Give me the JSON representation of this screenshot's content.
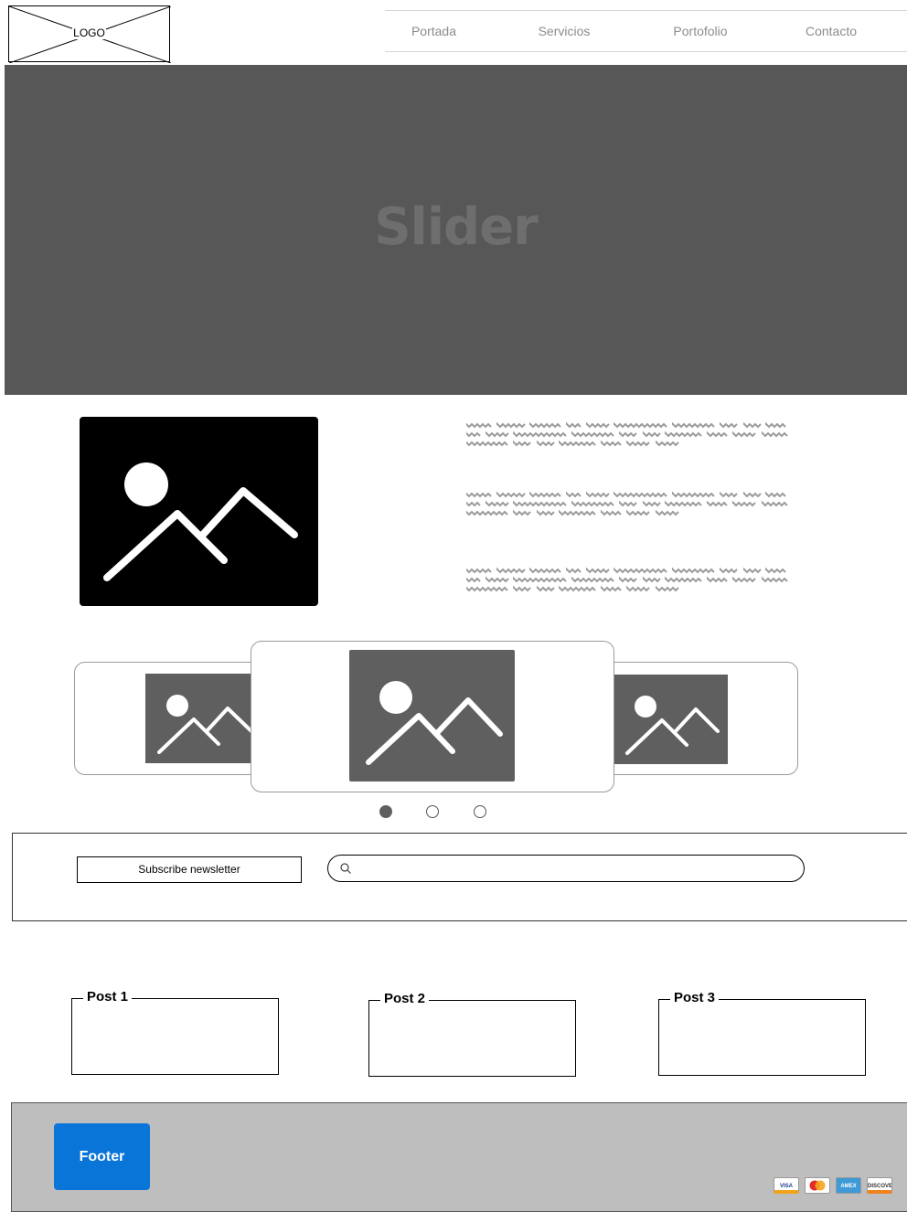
{
  "header": {
    "logo_text": "LOGO",
    "nav": [
      "Portada",
      "Servicios",
      "Portofolio",
      "Contacto"
    ]
  },
  "hero": {
    "title": "Slider"
  },
  "carousel": {
    "pages": 3,
    "active_index": 0
  },
  "newsletter": {
    "button_label": "Subscribe newsletter",
    "search_placeholder": ""
  },
  "posts": [
    "Post 1",
    "Post 2",
    "Post 3"
  ],
  "footer": {
    "button_label": "Footer",
    "payment_cards": [
      "VISA",
      "MasterCard",
      "AMEX",
      "DISCOVER"
    ]
  },
  "colors": {
    "hero_bg": "#575757",
    "footer_bg": "#bebebe",
    "footer_button": "#0a75d8",
    "image_placeholder": "#5f5f5f"
  }
}
